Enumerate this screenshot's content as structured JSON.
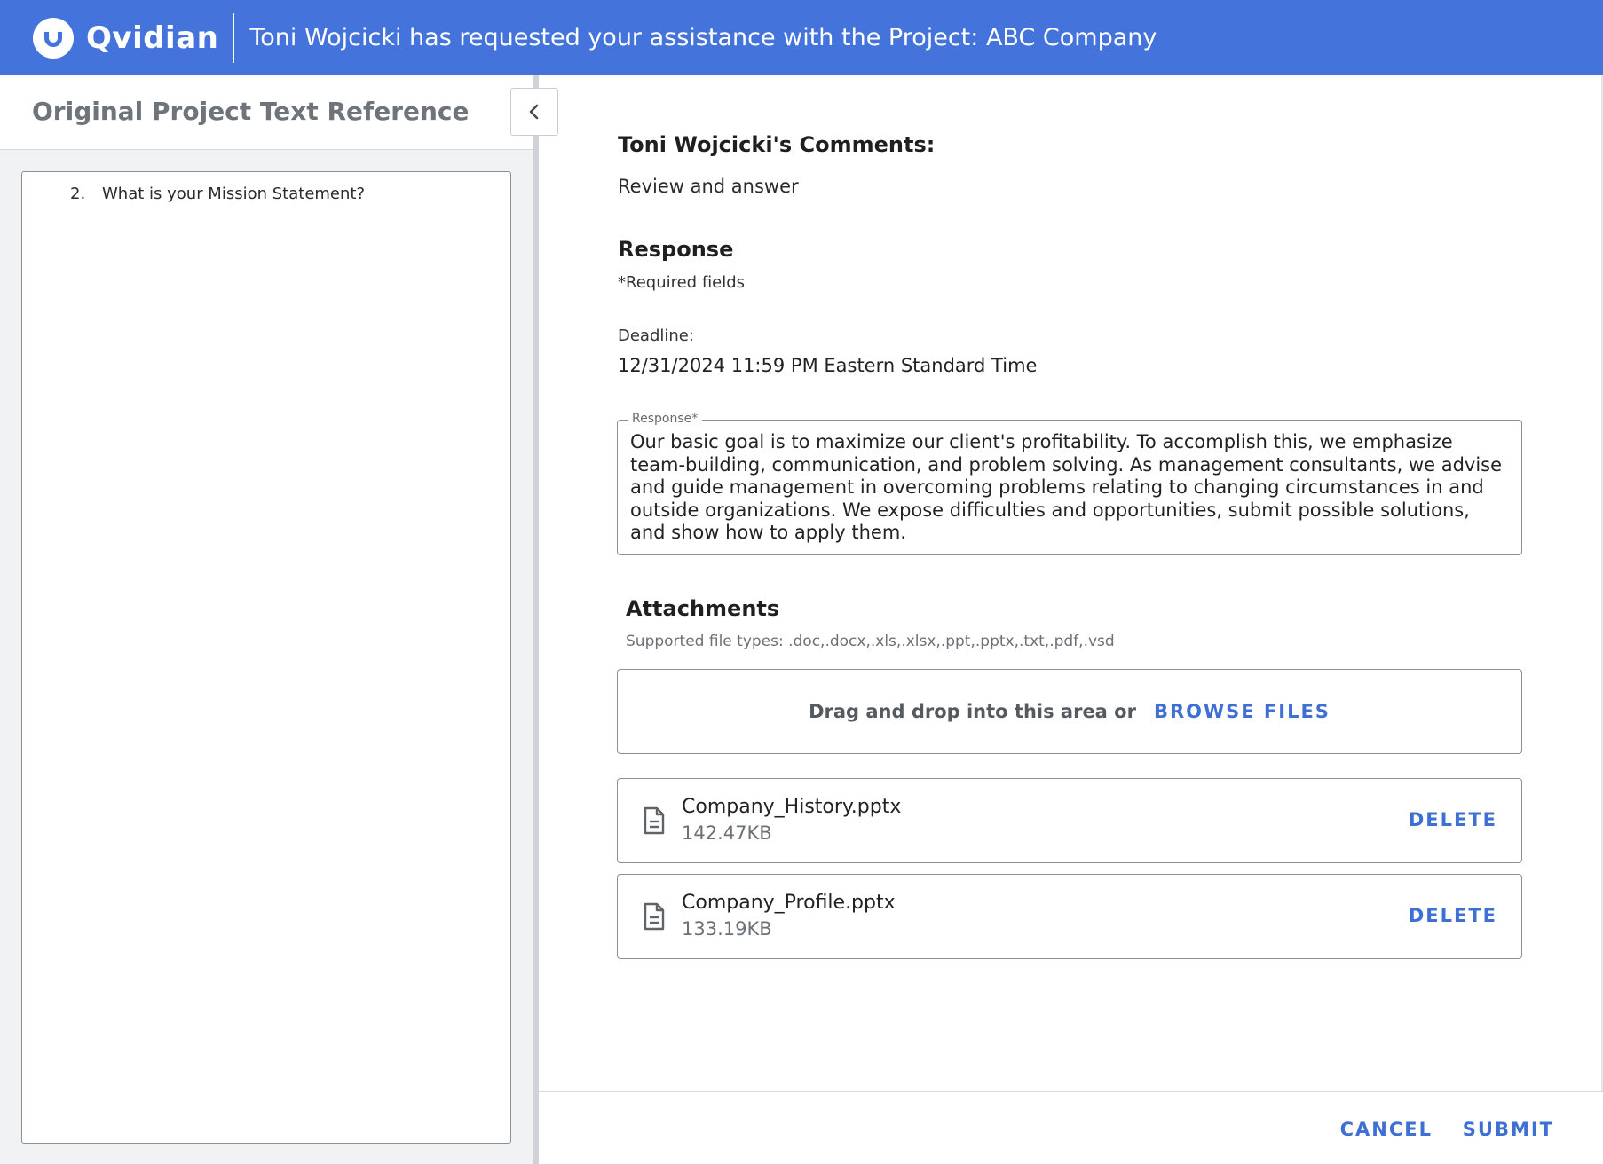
{
  "header": {
    "logo_text": "Qvidian",
    "title": "Toni Wojcicki has requested your assistance with the Project: ABC Company"
  },
  "left_panel": {
    "title": "Original Project Text Reference",
    "reference_items": [
      {
        "number": "2.",
        "text": "What is your Mission Statement?"
      }
    ]
  },
  "right_panel": {
    "comments_heading": "Toni Wojcicki's Comments:",
    "comments_text": "Review and answer",
    "response_heading": "Response",
    "required_note": "*Required fields",
    "deadline_label": "Deadline:",
    "deadline_value": "12/31/2024 11:59 PM Eastern Standard Time",
    "response_field": {
      "label": "Response*",
      "value": "Our basic goal is to maximize our client's profitability. To accomplish this, we emphasize team-building, communication, and problem solving. As management consultants, we advise and guide management in overcoming problems relating to changing circumstances in and outside organizations. We expose difficulties and opportunities, submit possible solutions, and show how to apply them."
    },
    "attachments": {
      "heading": "Attachments",
      "supported_types": "Supported file types: .doc,.docx,.xls,.xlsx,.ppt,.pptx,.txt,.pdf,.vsd",
      "drop_label": "Drag and drop into this area or",
      "browse_label": "BROWSE FILES",
      "files": [
        {
          "name": "Company_History.pptx",
          "size": "142.47KB",
          "delete_label": "DELETE",
          "icon": "document-icon"
        },
        {
          "name": "Company_Profile.pptx",
          "size": "133.19KB",
          "delete_label": "DELETE",
          "icon": "document-icon"
        }
      ]
    }
  },
  "footer": {
    "cancel_label": "CANCEL",
    "submit_label": "SUBMIT"
  },
  "colors": {
    "header_bg": "#4474db",
    "accent": "#3e6fd3",
    "left_panel_bg": "#f1f2f3"
  },
  "icons": {
    "logo": "qvidian-logo-icon",
    "collapse": "chevron-left-icon",
    "file": "document-icon"
  }
}
